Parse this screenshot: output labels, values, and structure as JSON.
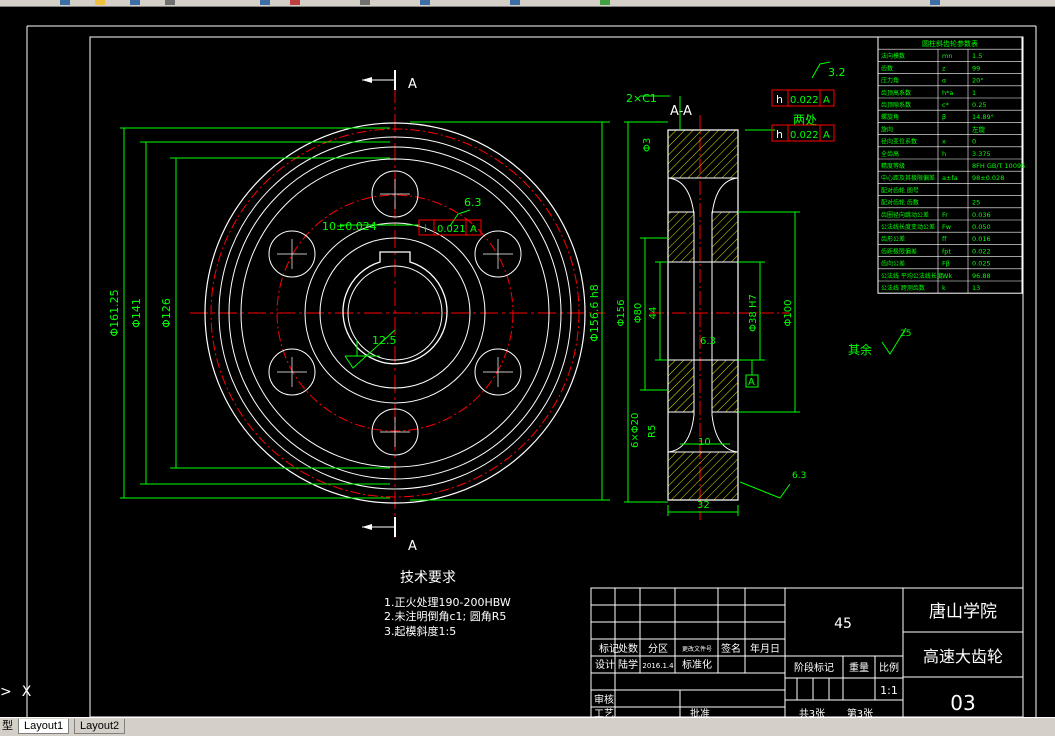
{
  "colors": {
    "background": "#000000",
    "geometry": "#ffffff",
    "dimension": "#00ff00",
    "centerline": "#ff0000",
    "hatch": "#e6e600",
    "datum": "#ff0000",
    "tab_bar": "#d4d0c8"
  },
  "toolbar": {
    "icons": [
      "new-icon",
      "open-icon",
      "save-icon",
      "print-icon",
      "cut-icon",
      "copy-icon",
      "paste-icon",
      "undo-icon",
      "layer-icon",
      "properties-icon",
      "help-icon"
    ]
  },
  "tabs": {
    "model_label": "型",
    "layout1_label": "Layout1",
    "layout2_label": "Layout2"
  },
  "ucs": {
    "x_label": "X"
  },
  "drawing": {
    "section_marker": "A",
    "section_view_label": "A-A",
    "front_dims": {
      "d1": "Φ161.25",
      "d2": "Φ141",
      "d3": "Φ126",
      "d4": "Φ156.6 h8",
      "keyway": "10±0.024",
      "keyway_tol": "i",
      "keyway_tol_val": "0.021",
      "keyway_datum": "A",
      "rough_key": "6.3",
      "rough_bore": "12.5"
    },
    "section_dims": {
      "chamfer": "2×C1",
      "fcf1_sym": "h",
      "fcf1_val": "0.022",
      "fcf1_datum": "A",
      "rough_top": "3.2",
      "two_places": "两处",
      "fcf2_sym": "h",
      "fcf2_val": "0.022",
      "fcf2_datum": "A",
      "d_face": "Φ3",
      "d_156": "Φ156",
      "d_80": "Φ80",
      "d_44": "44",
      "d_38": "Φ38 H7",
      "d_100": "Φ100",
      "rough_web": "6.3",
      "datum_a": "A",
      "hole_dia": "6×Φ20",
      "hole_r": "R5",
      "web": "10",
      "width": "32",
      "rough_side": "6.3"
    },
    "rest_rough": "其余",
    "rest_rough_val": "25"
  },
  "gear_table": {
    "title": "圆柱斜齿轮参数表",
    "rows": [
      [
        "法向模数",
        "mn",
        "1.5"
      ],
      [
        "齿数",
        "z",
        "99"
      ],
      [
        "压力角",
        "α",
        "20°"
      ],
      [
        "齿顶高系数",
        "h*a",
        "1"
      ],
      [
        "齿顶隙系数",
        "c*",
        "0.25"
      ],
      [
        "螺旋角",
        "β",
        "14.89°"
      ],
      [
        "旋向",
        "",
        "左旋"
      ],
      [
        "径向变位系数",
        "x",
        "0"
      ],
      [
        "全齿高",
        "h",
        "3.375"
      ],
      [
        "精度等级",
        "",
        "8FH GB/T 10095"
      ],
      [
        "中心距及其极限偏差",
        "a±fa",
        "98±0.028"
      ],
      [
        "配对齿轮 图号",
        "",
        ""
      ],
      [
        "配对齿轮 齿数",
        "",
        "25"
      ],
      [
        "齿圈径向跳动公差",
        "Fr",
        "0.036"
      ],
      [
        "公法线长度变动公差",
        "Fw",
        "0.050"
      ],
      [
        "齿形公差",
        "ff",
        "0.016"
      ],
      [
        "齿距极限偏差",
        "fpt",
        "0.022"
      ],
      [
        "齿向公差",
        "Fβ",
        "0.025"
      ],
      [
        "公法线 平均公法线长度",
        "Wk",
        "96.88"
      ],
      [
        "公法线 跨测齿数",
        "k",
        "13"
      ]
    ]
  },
  "tech_req": {
    "title": "技术要求",
    "items": [
      "1.正火处理190-200HBW",
      "2.未注明倒角c1; 圆角R5",
      "3.起模斜度1:5"
    ]
  },
  "title_block": {
    "material": "45",
    "school": "唐山学院",
    "part_name": "高速大齿轮",
    "drawing_no": "03",
    "col_labels": [
      "标记",
      "处数",
      "分区",
      "更改文件号",
      "签名",
      "年月日"
    ],
    "design_label": "设计",
    "designer": "陆学",
    "design_date": "2016.1.4",
    "standard_label": "标准化",
    "stage_label": "阶段标记",
    "weight_label": "重量",
    "scale_label": "比例",
    "scale_value": "1:1",
    "review_label": "审核",
    "process_label": "工艺",
    "approve_label": "批准",
    "sheets_total": "共3张",
    "sheet_no": "第3张"
  }
}
